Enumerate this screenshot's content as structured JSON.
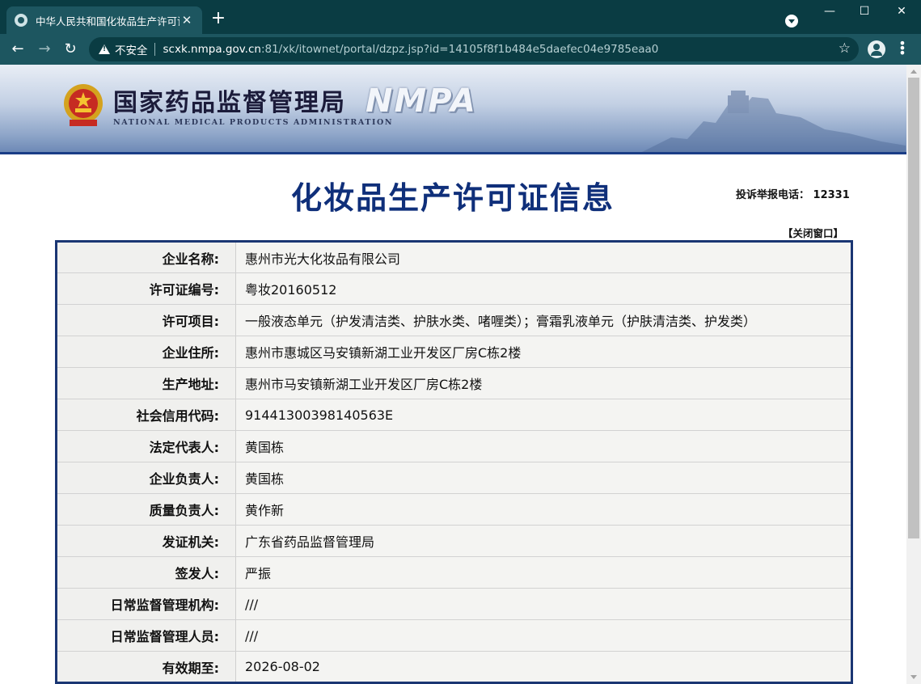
{
  "browser": {
    "tab_title": "中华人民共和国化妆品生产许可证",
    "tab_close": "✕",
    "new_tab": "+",
    "security_label": "不安全",
    "url_host": "scxk.nmpa.gov.cn",
    "url_rest": ":81/xk/itownet/portal/dzpz.jsp?id=14105f8f1b484e5daefec04e9785eaa0",
    "icons": {
      "back": "back-arrow-icon",
      "forward": "forward-arrow-icon",
      "reload": "reload-icon",
      "warning": "warning-icon",
      "star": "star-icon",
      "avatar": "avatar-icon",
      "menu": "kebab-menu-icon"
    }
  },
  "header": {
    "org_name_cn": "国家药品监督管理局",
    "org_name_en": "NATIONAL MEDICAL PRODUCTS ADMINISTRATION",
    "org_abbr": "NMPA"
  },
  "page": {
    "title": "化妆品生产许可证信息",
    "hotline": "投诉举报电话：  12331",
    "close_link": "【关闭窗口】"
  },
  "rows": [
    {
      "label": "企业名称:",
      "value": "惠州市光大化妆品有限公司"
    },
    {
      "label": "许可证编号:",
      "value": "粤妆20160512"
    },
    {
      "label": "许可项目:",
      "value": "一般液态单元（护发清洁类、护肤水类、啫喱类）；膏霜乳液单元（护肤清洁类、护发类）"
    },
    {
      "label": "企业住所:",
      "value": "惠州市惠城区马安镇新湖工业开发区厂房C栋2楼"
    },
    {
      "label": "生产地址:",
      "value": "惠州市马安镇新湖工业开发区厂房C栋2楼"
    },
    {
      "label": "社会信用代码:",
      "value": "91441300398140563E"
    },
    {
      "label": "法定代表人:",
      "value": "黄国栋"
    },
    {
      "label": "企业负责人:",
      "value": "黄国栋"
    },
    {
      "label": "质量负责人:",
      "value": "黄作新"
    },
    {
      "label": "发证机关:",
      "value": "广东省药品监督管理局"
    },
    {
      "label": "签发人:",
      "value": "严振"
    },
    {
      "label": "日常监督管理机构:",
      "value": "///"
    },
    {
      "label": "日常监督管理人员:",
      "value": "///"
    },
    {
      "label": "有效期至:",
      "value": "2026-08-02"
    }
  ]
}
